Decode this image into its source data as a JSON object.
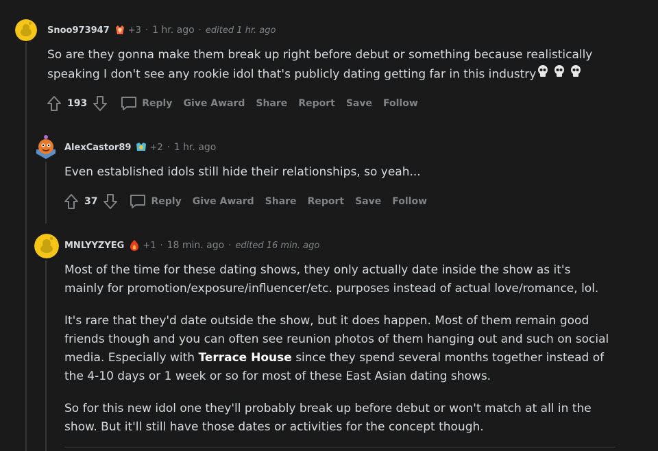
{
  "comments": [
    {
      "author": "Snoo973947",
      "awards": "+3",
      "time": "1 hr. ago",
      "edited": "edited 1 hr. ago",
      "body": [
        "So are they gonna make them break up right before debut or something because realistically speaking I don't see any rookie idol that's publicly dating getting far in this industry"
      ],
      "score": "193",
      "colors": {
        "avatar_bg": "#f5c518",
        "award": "#ff6a3d"
      }
    },
    {
      "author": "AlexCastor89",
      "awards": "+2",
      "time": "1 hr. ago",
      "body": [
        "Even established idols still hide their relationships, so yeah..."
      ],
      "score": "37",
      "colors": {
        "avatar_bg": "#e87b2b",
        "award": "#4fbcd8"
      }
    },
    {
      "author": "MNLYYZYEG",
      "awards": "+1",
      "time": "18 min. ago",
      "edited": "edited 16 min. ago",
      "body": [
        "Most of the time for these dating shows, they only actually date inside the show as it's mainly for promotion/exposure/influencer/etc. purposes instead of actual love/romance, lol.",
        "It's rare that they'd date outside the show, but it does happen. Most of them remain good friends though and you can often see reunion photos of them hanging out and such on social media. Especially with",
        "Terrace House",
        "since they spend several months together instead of the 4-10 days or 1 week or so for most of these East Asian dating shows.",
        "So for this new idol one they'll probably break up before debut or won't match at all in the show. But it'll still have those dates or activities for the concept though."
      ],
      "colors": {
        "avatar_bg": "#f5c518",
        "award": "#e63d1c"
      }
    }
  ],
  "actions": {
    "reply": "Reply",
    "give_award": "Give Award",
    "share": "Share",
    "report": "Report",
    "save": "Save",
    "follow": "Follow"
  },
  "icons": {
    "upvote": "upvote-arrow-icon",
    "downvote": "downvote-arrow-icon",
    "reply": "speech-bubble-icon",
    "skull": "skull-emoji-icon"
  }
}
